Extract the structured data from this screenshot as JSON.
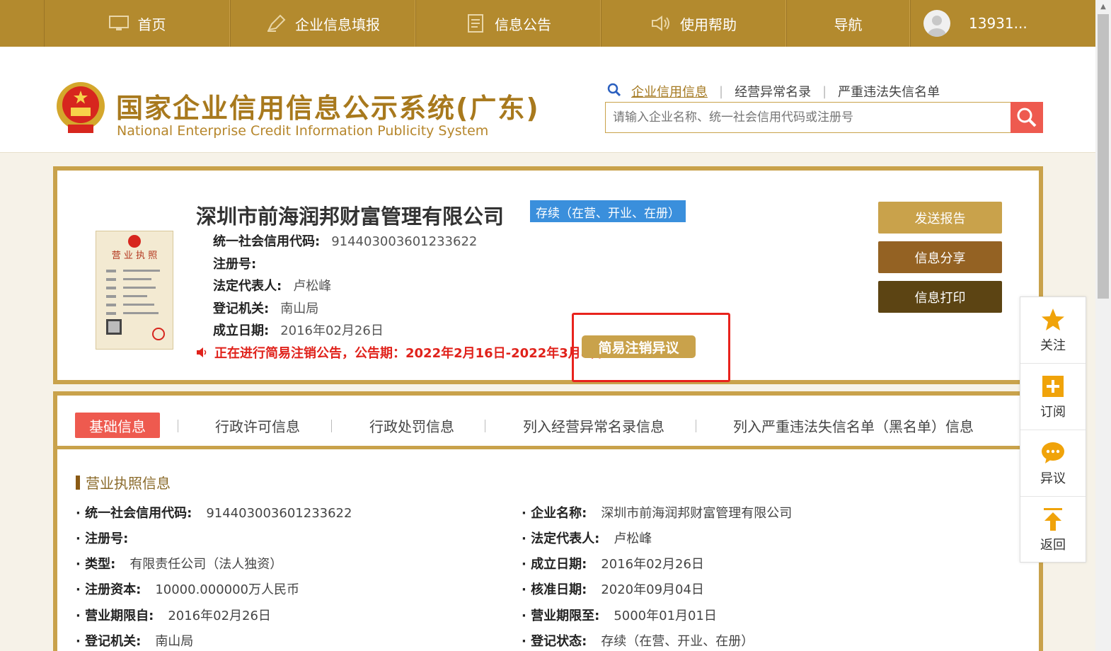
{
  "nav": {
    "items": [
      {
        "label": "首页",
        "icon": "monitor-icon"
      },
      {
        "label": "企业信息填报",
        "icon": "pen-icon"
      },
      {
        "label": "信息公告",
        "icon": "document-icon"
      },
      {
        "label": "使用帮助",
        "icon": "speaker-icon"
      },
      {
        "label": "导航",
        "icon": ""
      }
    ],
    "user": "13931..."
  },
  "header": {
    "title": "国家企业信用信息公示系统(广东)",
    "subtitle": "National Enterprise Credit Information Publicity System",
    "search_links": [
      "企业信用信息",
      "经营异常名录",
      "严重违法失信名单"
    ],
    "search_placeholder": "请输入企业名称、统一社会信用代码或注册号"
  },
  "company": {
    "name": "深圳市前海润邦财富管理有限公司",
    "status": "存续（在营、开业、在册）",
    "fields": [
      {
        "key": "统一社会信用代码:",
        "value": "914403003601233622"
      },
      {
        "key": "注册号:",
        "value": ""
      },
      {
        "key": "法定代表人:",
        "value": "卢松峰"
      },
      {
        "key": "登记机关:",
        "value": "南山局"
      },
      {
        "key": "成立日期:",
        "value": "2016年02月26日"
      }
    ],
    "notice": "正在进行简易注销公告，公告期：2022年2月16日-2022年3月8日",
    "objection_button": "简易注销异议",
    "actions": [
      "发送报告",
      "信息分享",
      "信息打印"
    ]
  },
  "tabs": [
    "基础信息",
    "行政许可信息",
    "行政处罚信息",
    "列入经营异常名录信息",
    "列入严重违法失信名单（黑名单）信息"
  ],
  "section": {
    "title": "营业执照信息",
    "left": [
      {
        "key": "统一社会信用代码:",
        "value": "914403003601233622"
      },
      {
        "key": "注册号:",
        "value": ""
      },
      {
        "key": "类型:",
        "value": "有限责任公司（法人独资）"
      },
      {
        "key": "注册资本:",
        "value": "10000.000000万人民币"
      },
      {
        "key": "营业期限自:",
        "value": "2016年02月26日"
      },
      {
        "key": "登记机关:",
        "value": "南山局"
      }
    ],
    "right": [
      {
        "key": "企业名称:",
        "value": "深圳市前海润邦财富管理有限公司"
      },
      {
        "key": "法定代表人:",
        "value": "卢松峰"
      },
      {
        "key": "成立日期:",
        "value": "2016年02月26日"
      },
      {
        "key": "核准日期:",
        "value": "2020年09月04日"
      },
      {
        "key": "营业期限至:",
        "value": "5000年01月01日"
      },
      {
        "key": "登记状态:",
        "value": "存续（在营、开业、在册）"
      }
    ]
  },
  "float_menu": [
    {
      "label": "关注",
      "icon": "star-icon"
    },
    {
      "label": "订阅",
      "icon": "plus-square-icon"
    },
    {
      "label": "异议",
      "icon": "chat-icon"
    },
    {
      "label": "返回",
      "icon": "arrow-up-icon"
    }
  ],
  "colors": {
    "gold": "#b38a2e",
    "accent": "#c9a24b",
    "red": "#e0221b",
    "blue": "#3a8fdc",
    "tab_active": "#ee5a4f"
  }
}
